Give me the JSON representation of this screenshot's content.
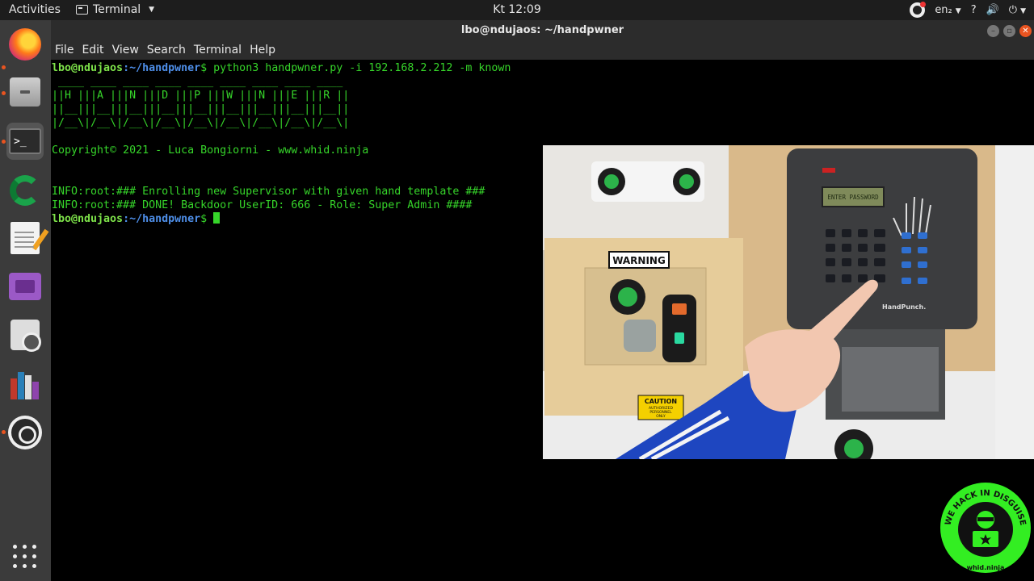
{
  "topbar": {
    "activities": "Activities",
    "app_name": "Terminal",
    "clock": "Kt 12:09",
    "lang": "en₂",
    "help": "?",
    "volume": "🔊",
    "power": "⏻"
  },
  "window": {
    "title": "lbo@ndujaos: ~/handpwner",
    "menu": [
      "File",
      "Edit",
      "View",
      "Search",
      "Terminal",
      "Help"
    ]
  },
  "terminal": {
    "prompt_user": "lbo@ndujaos",
    "prompt_path": ":~/handpwner",
    "prompt_symbol": "$",
    "command": " python3 handpwner.py -i 192.168.2.212 -m known",
    "banner": [
      " ____ ____ ____ ____ ____ ____ ____ ____ ____",
      "||H |||A |||N |||D |||P |||W |||N |||E |||R ||",
      "||__|||__|||__|||__|||__|||__|||__|||__|||__||",
      "|/__\\|/__\\|/__\\|/__\\|/__\\|/__\\|/__\\|/__\\|/__\\|"
    ],
    "copyright": "Copyright© 2021 - Luca Bongiorni - www.whid.ninja",
    "info1": "INFO:root:### Enrolling new Supervisor with given hand template ###",
    "info2": "INFO:root:### DONE! Backdoor UserID: 666 - Role: Super Admin ####"
  },
  "webcam": {
    "lcd_text": "ENTER PASSWORD",
    "brand": "HandPunch.",
    "warning_sign": "WARNING",
    "caution_title": "CAUTION",
    "caution_lines": [
      "AUTHORIZED",
      "PERSONNEL",
      "ONLY"
    ]
  },
  "badge": {
    "top_text": "WE HACK IN DISGUISE",
    "bottom_text": "whid.ninja"
  },
  "colors": {
    "terminal_green": "#36d52a",
    "prompt_blue": "#4e8ee8",
    "ubuntu_orange": "#e95420",
    "badge_green": "#33ee22"
  }
}
